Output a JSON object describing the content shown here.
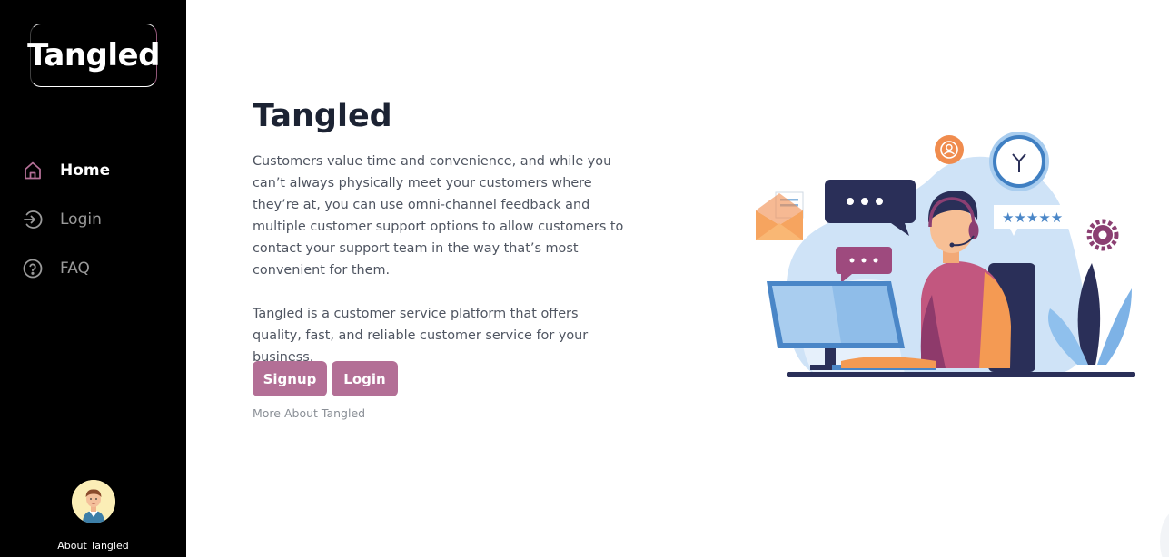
{
  "sidebar": {
    "logo_text": "Tangled",
    "nav": [
      {
        "label": "Home",
        "icon": "home-icon",
        "active": true
      },
      {
        "label": "Login",
        "icon": "login-icon",
        "active": false
      },
      {
        "label": "FAQ",
        "icon": "question-circle-icon",
        "active": false
      }
    ],
    "about_label": "About Tangled"
  },
  "main": {
    "title": "Tangled",
    "paragraph1": "Customers value time and convenience, and while you can’t always physically meet your customers where they’re at, you can use omni-channel feedback and multiple customer support options to allow customers to contact your support team in the way that’s most convenient for them.",
    "paragraph2": "Tangled is a customer service platform that offers quality, fast, and reliable customer service for your business.",
    "signup_label": "Signup",
    "login_label": "Login",
    "more_link": "More About Tangled"
  },
  "colors": {
    "sidebar_bg": "#000000",
    "accent": "#b36f96",
    "title": "#1c2333",
    "body_text": "#4f5561"
  }
}
